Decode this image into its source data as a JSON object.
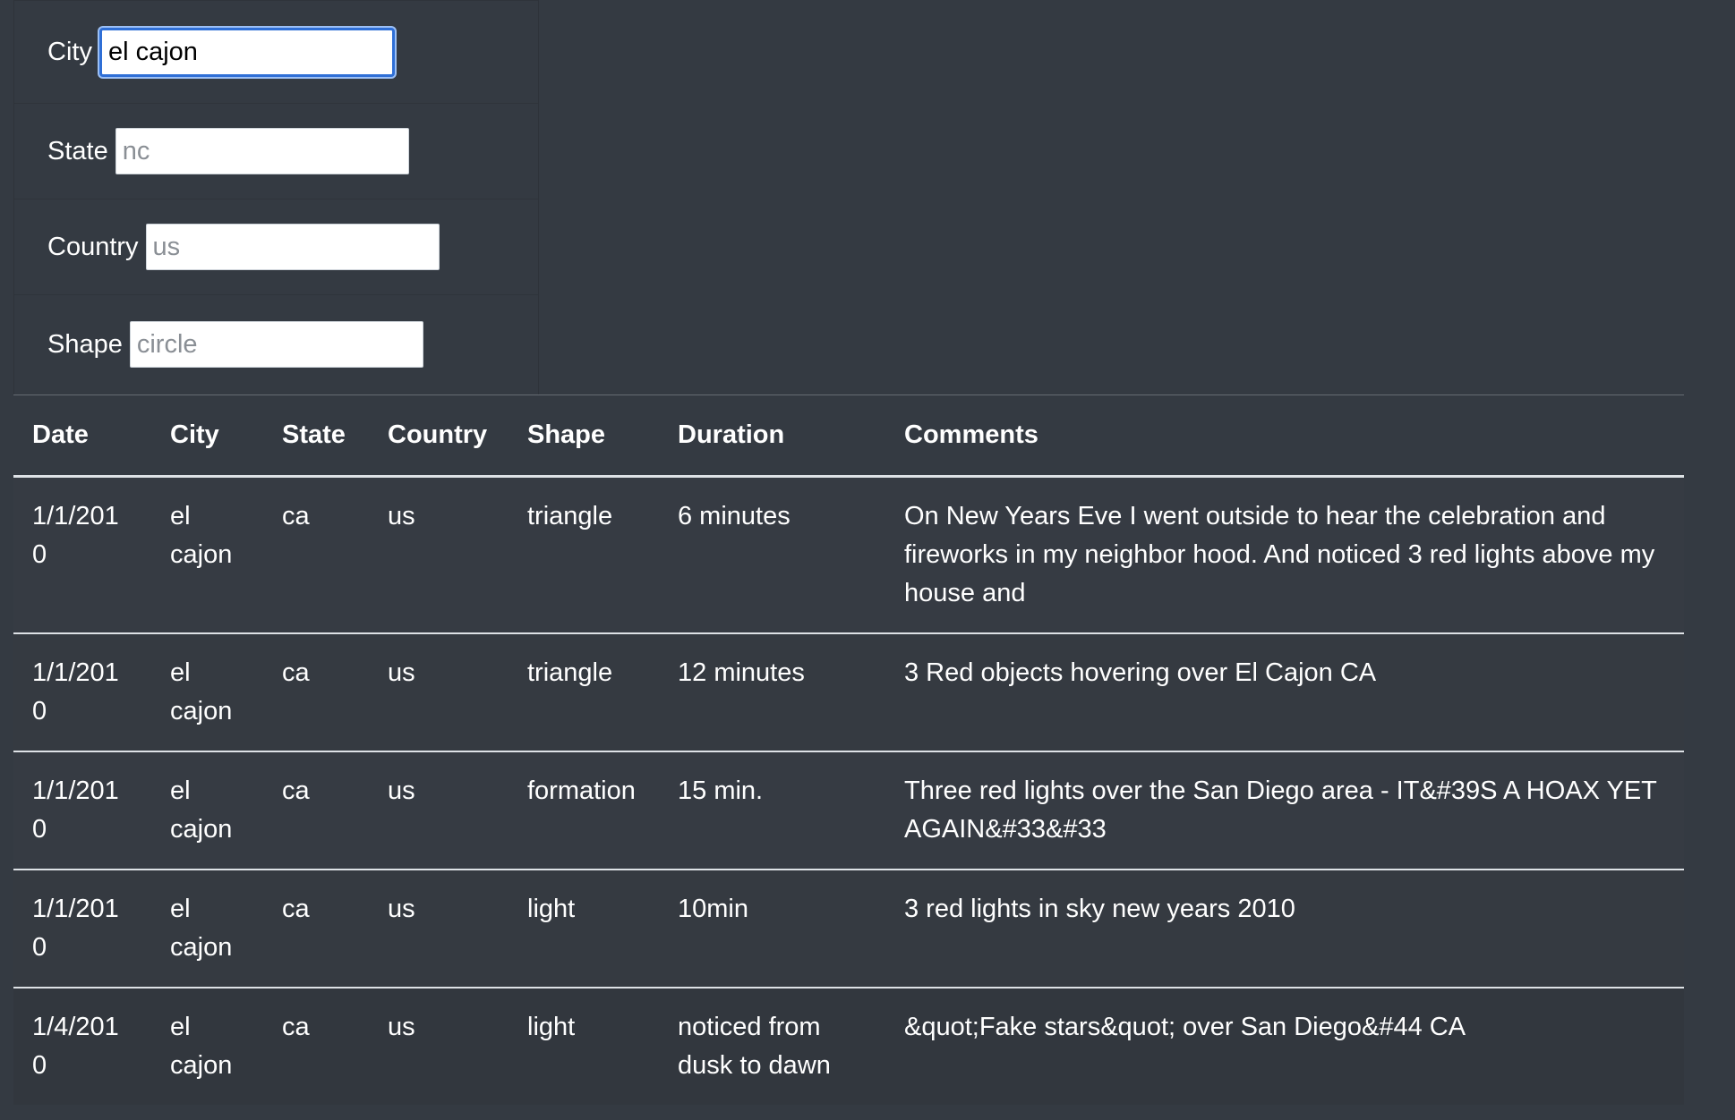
{
  "filters": [
    {
      "label": "City",
      "value": "el cajon",
      "placeholder": "",
      "focused": true
    },
    {
      "label": "State",
      "value": "",
      "placeholder": "nc",
      "focused": false
    },
    {
      "label": "Country",
      "value": "",
      "placeholder": "us",
      "focused": false
    },
    {
      "label": "Shape",
      "value": "",
      "placeholder": "circle",
      "focused": false
    }
  ],
  "table": {
    "headers": [
      "Date",
      "City",
      "State",
      "Country",
      "Shape",
      "Duration",
      "Comments"
    ],
    "rows": [
      [
        "1/1/2010",
        "el cajon",
        "ca",
        "us",
        "triangle",
        "6 minutes",
        "On New Years Eve I went outside to hear the celebration and fireworks in my neighbor hood. And noticed 3 red lights above my house and"
      ],
      [
        "1/1/2010",
        "el cajon",
        "ca",
        "us",
        "triangle",
        "12 minutes",
        "3 Red objects hovering over El Cajon CA"
      ],
      [
        "1/1/2010",
        "el cajon",
        "ca",
        "us",
        "formation",
        "15 min.",
        "Three red lights over the San Diego area - IT&#39S A HOAX YET AGAIN&#33&#33"
      ],
      [
        "1/1/2010",
        "el cajon",
        "ca",
        "us",
        "light",
        "10min",
        "3 red lights in sky new years 2010"
      ],
      [
        "1/4/2010",
        "el cajon",
        "ca",
        "us",
        "light",
        "noticed from dusk to dawn",
        "&quot;Fake stars&quot; over San Diego&#44 CA"
      ]
    ]
  }
}
